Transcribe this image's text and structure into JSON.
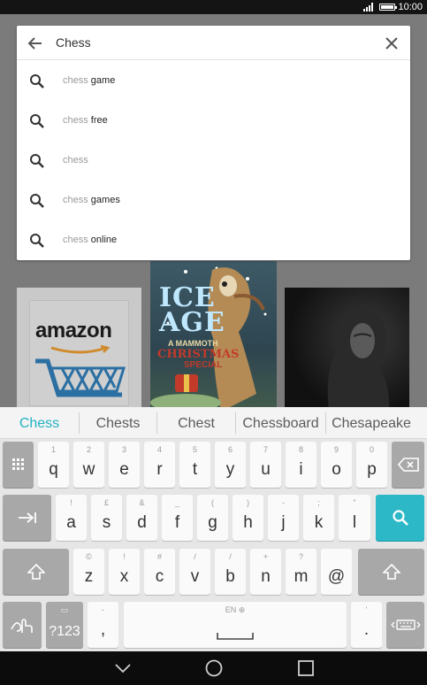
{
  "status_bar": {
    "time": "10:00",
    "icons": [
      "signal-icon",
      "battery-icon"
    ]
  },
  "search": {
    "query": "Chess",
    "suggestions": [
      {
        "typed": "chess",
        "completion": " game"
      },
      {
        "typed": "chess",
        "completion": " free"
      },
      {
        "typed": "chess",
        "completion": ""
      },
      {
        "typed": "chess",
        "completion": " games"
      },
      {
        "typed": "chess",
        "completion": " online"
      }
    ]
  },
  "background_cards": {
    "amazon": {
      "wordmark": "amazon"
    },
    "ice_age": {
      "title_line1": "ICE",
      "title_line2": "AGE",
      "sub1": "A MAMMOTH",
      "sub2": "CHRISTMAS",
      "sub3": "SPECIAL"
    }
  },
  "keyboard": {
    "candidates": [
      "Chess",
      "Chests",
      "Chest",
      "Chessboard",
      "Chesapeake"
    ],
    "row1": [
      {
        "main": "q",
        "hint": "1"
      },
      {
        "main": "w",
        "hint": "2"
      },
      {
        "main": "e",
        "hint": "3"
      },
      {
        "main": "r",
        "hint": "4"
      },
      {
        "main": "t",
        "hint": "5"
      },
      {
        "main": "y",
        "hint": "6"
      },
      {
        "main": "u",
        "hint": "7"
      },
      {
        "main": "i",
        "hint": "8"
      },
      {
        "main": "o",
        "hint": "9"
      },
      {
        "main": "p",
        "hint": "0"
      }
    ],
    "row2": [
      {
        "main": "a",
        "hint": "!"
      },
      {
        "main": "s",
        "hint": "£"
      },
      {
        "main": "d",
        "hint": "&"
      },
      {
        "main": "f",
        "hint": "_"
      },
      {
        "main": "g",
        "hint": "("
      },
      {
        "main": "h",
        "hint": ")"
      },
      {
        "main": "j",
        "hint": "-"
      },
      {
        "main": "k",
        "hint": ";"
      },
      {
        "main": "l",
        "hint": "\""
      }
    ],
    "row3": [
      {
        "main": "z",
        "hint": "©"
      },
      {
        "main": "x",
        "hint": "!"
      },
      {
        "main": "c",
        "hint": "#"
      },
      {
        "main": "v",
        "hint": "/"
      },
      {
        "main": "b",
        "hint": "/"
      },
      {
        "main": "n",
        "hint": "+"
      },
      {
        "main": "m",
        "hint": "?"
      },
      {
        "main": "@",
        "hint": ""
      }
    ],
    "symbols_label": "?123",
    "comma": {
      "main": ",",
      "hint": "-"
    },
    "space_hint": "EN ⊕",
    "period": {
      "main": ".",
      "hint": "'"
    },
    "accent_color": "#2cb8c7"
  },
  "nav": {
    "icons": [
      "back-icon",
      "home-icon",
      "recents-icon"
    ]
  }
}
